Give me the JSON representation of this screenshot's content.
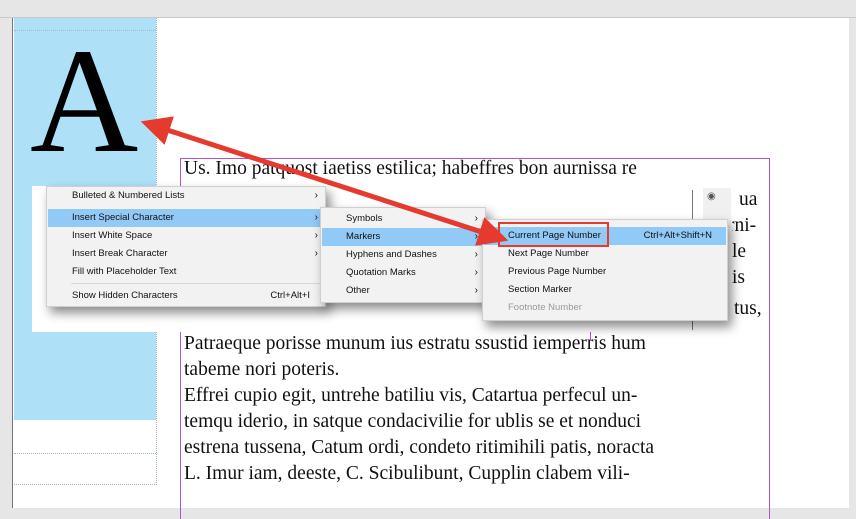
{
  "document": {
    "drop_cap": "A",
    "lines_above": [
      "Us. Imo patquost iaetiss estilica; habeffres bon aurnissa re"
    ],
    "lines_below": [
      "Patraeque porisse munum ius estratu ssustid iemperris hum",
      "tabeme nori poteris.",
      "Effrei cupio egit, untrehe batiliu vis, Catartua perfecul un-",
      "temqu iderio, in satque condacivilie for ublis se et nonduci",
      "estrena tussena, Catum ordi, condeto ritimihili patis, noracta",
      "L. Imur iam, deeste, C. Scibulibunt, Cupplin clabem vili-"
    ],
    "right_fragments": [
      "ua",
      "rni-",
      "le",
      "is",
      "tus,"
    ]
  },
  "context_menu": {
    "items": [
      {
        "label": "Bulleted & Numbered Lists",
        "shortcut": "",
        "submenu": true
      },
      {
        "label": "Insert Special Character",
        "shortcut": "",
        "submenu": true,
        "highlighted": true
      },
      {
        "label": "Insert White Space",
        "shortcut": "",
        "submenu": true
      },
      {
        "label": "Insert Break Character",
        "shortcut": "",
        "submenu": true
      },
      {
        "label": "Fill with Placeholder Text",
        "shortcut": "",
        "submenu": false
      },
      {
        "label": "Show Hidden Characters",
        "shortcut": "Ctrl+Alt+I",
        "submenu": false
      }
    ]
  },
  "special_char_menu": {
    "items": [
      {
        "label": "Symbols",
        "submenu": true
      },
      {
        "label": "Markers",
        "submenu": true,
        "highlighted": true
      },
      {
        "label": "Hyphens and Dashes",
        "submenu": true
      },
      {
        "label": "Quotation Marks",
        "submenu": true
      },
      {
        "label": "Other",
        "submenu": true
      }
    ]
  },
  "markers_menu": {
    "items": [
      {
        "label": "Current Page Number",
        "shortcut": "Ctrl+Alt+Shift+N",
        "highlighted": true
      },
      {
        "label": "Next Page Number",
        "shortcut": ""
      },
      {
        "label": "Previous Page Number",
        "shortcut": ""
      },
      {
        "label": "Section Marker",
        "shortcut": ""
      },
      {
        "label": "Footnote Number",
        "shortcut": "",
        "disabled": true
      }
    ]
  },
  "colors": {
    "highlight": "#91c9f7",
    "annotation_red": "#e53a2e",
    "drop_cap_frame": "#aee0f7",
    "frame_guide": "#b154c5"
  }
}
